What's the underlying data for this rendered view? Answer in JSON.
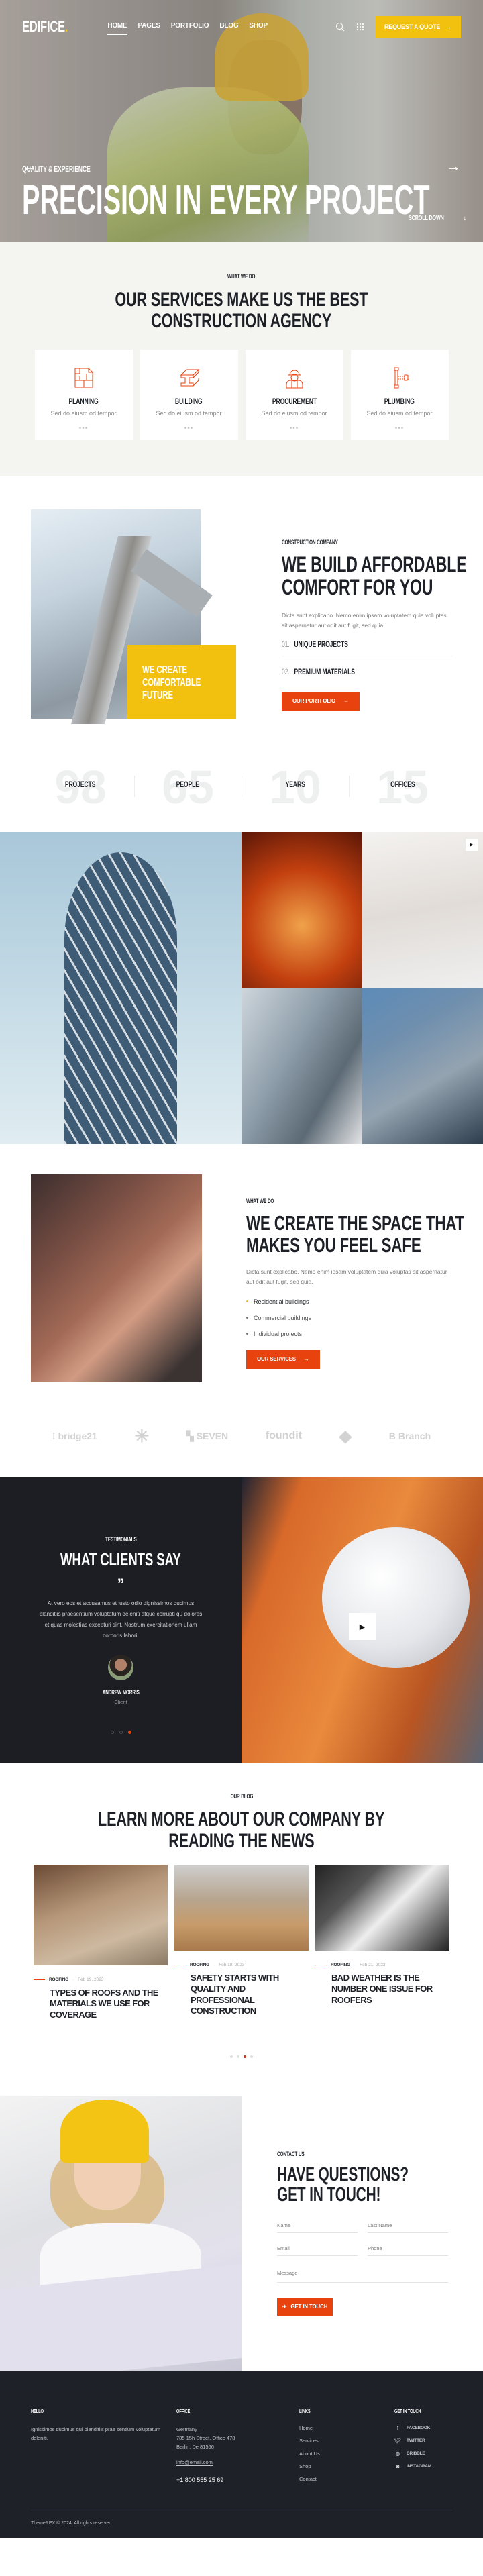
{
  "brand": {
    "name": "EDIFICE",
    "dot": ".",
    "accent": "#f2c00f",
    "red": "#e8420e"
  },
  "nav": {
    "items": [
      {
        "label": "Home",
        "active": true
      },
      {
        "label": "Pages"
      },
      {
        "label": "Portfolio"
      },
      {
        "label": "Blog"
      },
      {
        "label": "Shop"
      }
    ],
    "cta": "Request a Quote"
  },
  "hero": {
    "eyebrow": "Quality & Experience",
    "title": "Precision in every project",
    "scroll": "Scroll Down"
  },
  "services": {
    "eyebrow": "What we do",
    "title_1": "Our services make us the best",
    "title_2": "construction agency",
    "cards": [
      {
        "icon": "blueprint-icon",
        "title": "Planning",
        "desc": "Sed do eiusm od tempor",
        "more": "•••"
      },
      {
        "icon": "steel-beam-icon",
        "title": "Building",
        "desc": "Sed do eiusm od tempor",
        "more": "•••"
      },
      {
        "icon": "worker-icon",
        "title": "Procurement",
        "desc": "Sed do eiusm od tempor",
        "more": "•••"
      },
      {
        "icon": "pipe-icon",
        "title": "Plumbing",
        "desc": "Sed do eiusm od tempor",
        "more": "•••"
      }
    ]
  },
  "about": {
    "badge_1": "We create",
    "badge_2": "comfortable",
    "badge_3": "future",
    "eyebrow": "Construction company",
    "title_1": "We build affordable",
    "title_2": "comfort for you",
    "text": "Dicta sunt explicabo. Nemo enim ipsam voluptatem quia voluptas sit aspernatur aut odit aut fugit, sed quia.",
    "items": [
      {
        "num": "01.",
        "label": "Unique projects"
      },
      {
        "num": "02.",
        "label": "Premium materials"
      }
    ],
    "button": "Our portfolio"
  },
  "counters": [
    {
      "value": "98",
      "label": "Projects"
    },
    {
      "value": "65",
      "label": "People"
    },
    {
      "value": "10",
      "label": "Years"
    },
    {
      "value": "15",
      "label": "Offices"
    }
  ],
  "safe": {
    "eyebrow": "What we do",
    "title_1": "We create the space that",
    "title_2": "makes you feel safe",
    "text": "Dicta sunt explicabo. Nemo enim ipsam voluptatem quia voluptas sit aspernatur aut odit aut fugit, sed quia.",
    "bullets": [
      "Residential buildings",
      "Commercial buildings",
      "Individual projects"
    ],
    "button": "Our services"
  },
  "partners": [
    "bridge21",
    "",
    "SEVEN",
    "foundit",
    "",
    "Branch"
  ],
  "testimonials": {
    "eyebrow": "Testimonials",
    "title": "What clients say",
    "quote_mark": "”",
    "quote": "At vero eos et accusamus et iusto odio dignissimos ducimus blanditiis praesentium voluptatum deleniti atque corrupti qu dolores et quas molestias excepturi sint. Nostrum exercitationem ullam corporis labori.",
    "name": "Andrew Morris",
    "role": "Client",
    "active_slide": 3,
    "slides": 3
  },
  "blog": {
    "eyebrow": "Our blog",
    "title_1": "Learn more about our company by",
    "title_2": "reading the news",
    "posts": [
      {
        "category": "Roofing",
        "date": "Feb 19, 2023",
        "title": "Types of roofs and the materials we use for coverage"
      },
      {
        "category": "Roofing",
        "date": "Feb 18, 2023",
        "title": "Safety starts with quality and professional construction"
      },
      {
        "category": "Roofing",
        "date": "Feb 21, 2023",
        "title": "Bad weather is the number one issue for roofers"
      }
    ],
    "active_page": 3,
    "pages": 4
  },
  "contact": {
    "eyebrow": "Contact us",
    "title_1": "Have questions?",
    "title_2": "Get in touch!",
    "fields": {
      "name": "Name",
      "last_name": "Last Name",
      "email": "Email",
      "phone": "Phone",
      "message": "Message"
    },
    "button": "Get in touch"
  },
  "footer": {
    "hello_title": "Hello",
    "hello_text": "Ignissimos ducimus qui blanditiis prae sentium voluptatum deleniti.",
    "office_title": "Office",
    "address_1": "Germany —",
    "address_2": "785 15h Street, Office 478",
    "address_3": "Berlin, De 81566",
    "email": "info@email.com",
    "phone": "+1 800 555 25 69",
    "links_title": "Links",
    "links": [
      "Home",
      "Services",
      "About Us",
      "Shop",
      "Contact"
    ],
    "social_title": "Get in touch",
    "social": [
      {
        "icon": "facebook-icon",
        "label": "Facebook"
      },
      {
        "icon": "twitter-icon",
        "label": "Twitter"
      },
      {
        "icon": "dribbble-icon",
        "label": "Dribble"
      },
      {
        "icon": "instagram-icon",
        "label": "Instagram"
      }
    ],
    "copyright": "ThemeREX © 2024. All rights reserved."
  }
}
